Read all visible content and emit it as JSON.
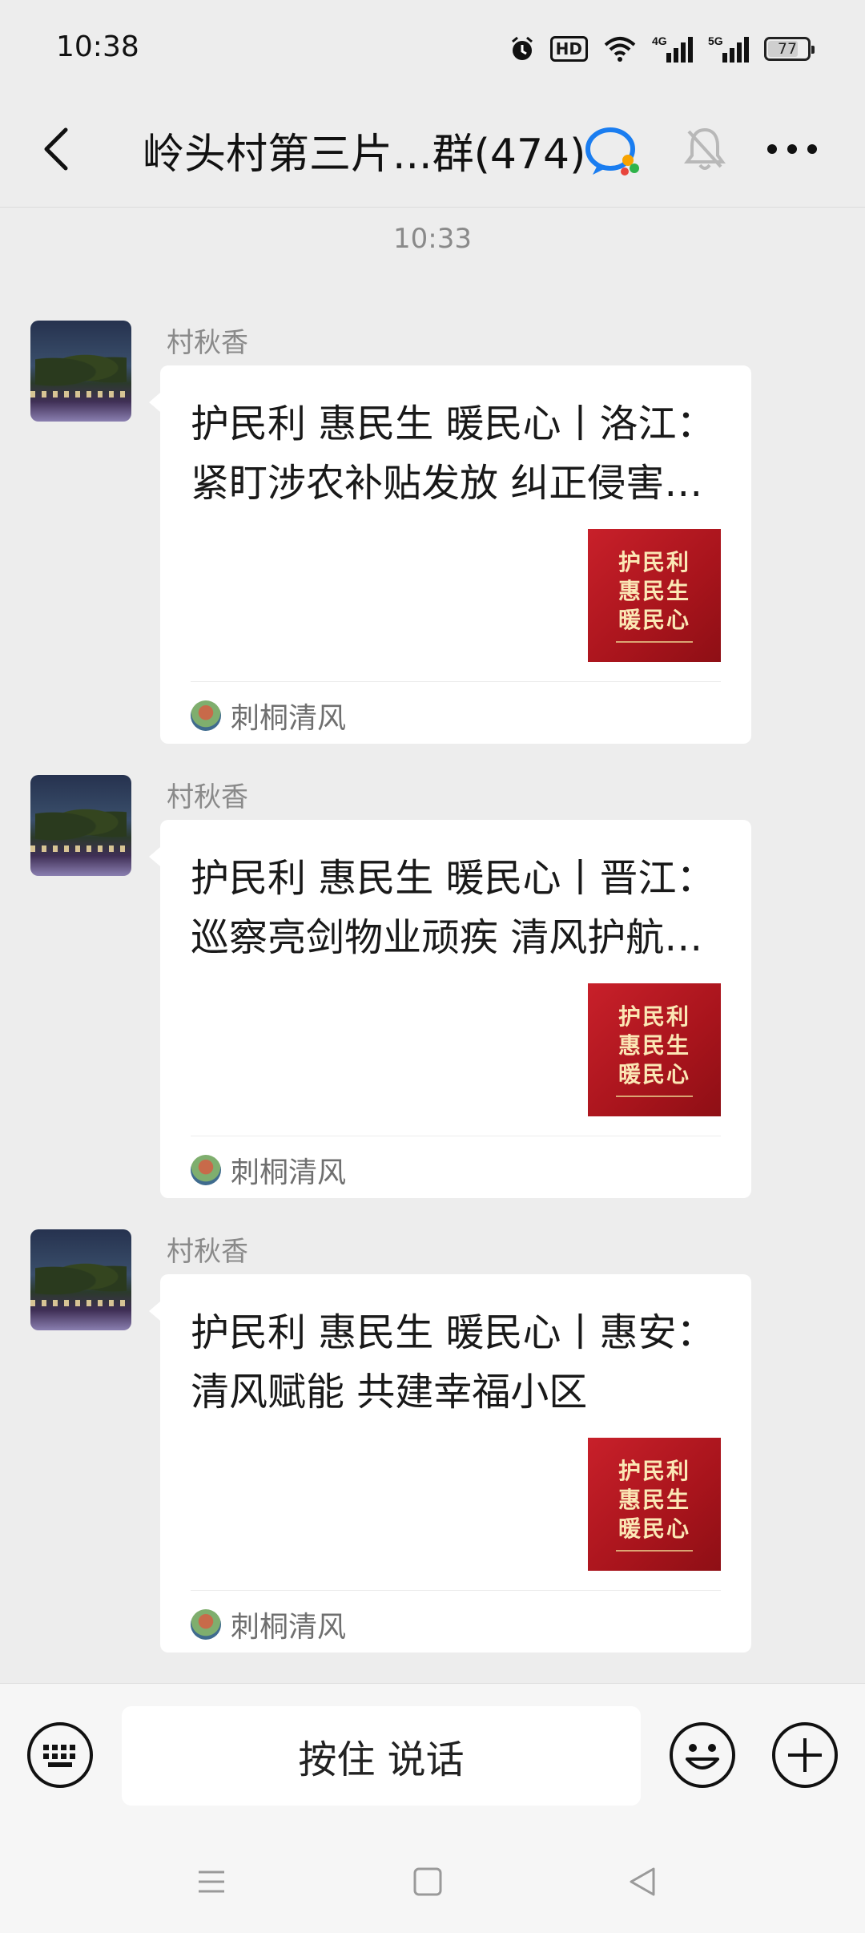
{
  "status_bar": {
    "time": "10:38",
    "hd_label": "HD",
    "net_4g": "4G",
    "net_5g": "5G",
    "battery_level": "77"
  },
  "header": {
    "title": "岭头村第三片...群(474)"
  },
  "chat": {
    "timestamp": "10:33",
    "messages": [
      {
        "sender": "村秋香",
        "card_title": "护民利 惠民生 暖民心丨洛江：紧盯涉农补贴发放 纠正侵害群众利益问题",
        "thumb_lines": [
          "护民利",
          "惠民生",
          "暖民心"
        ],
        "source": "刺桐清风"
      },
      {
        "sender": "村秋香",
        "card_title": "护民利 惠民生 暖民心丨晋江：巡察亮剑物业顽疾  清风护航美好生活",
        "thumb_lines": [
          "护民利",
          "惠民生",
          "暖民心"
        ],
        "source": "刺桐清风"
      },
      {
        "sender": "村秋香",
        "card_title": "护民利 惠民生 暖民心丨惠安：清风赋能 共建幸福小区",
        "thumb_lines": [
          "护民利",
          "惠民生",
          "暖民心"
        ],
        "source": "刺桐清风"
      }
    ]
  },
  "input_bar": {
    "voice_label": "按住 说话"
  },
  "colors": {
    "background": "#ededed",
    "bubble": "#ffffff",
    "thumb_red": "#c8202a"
  }
}
